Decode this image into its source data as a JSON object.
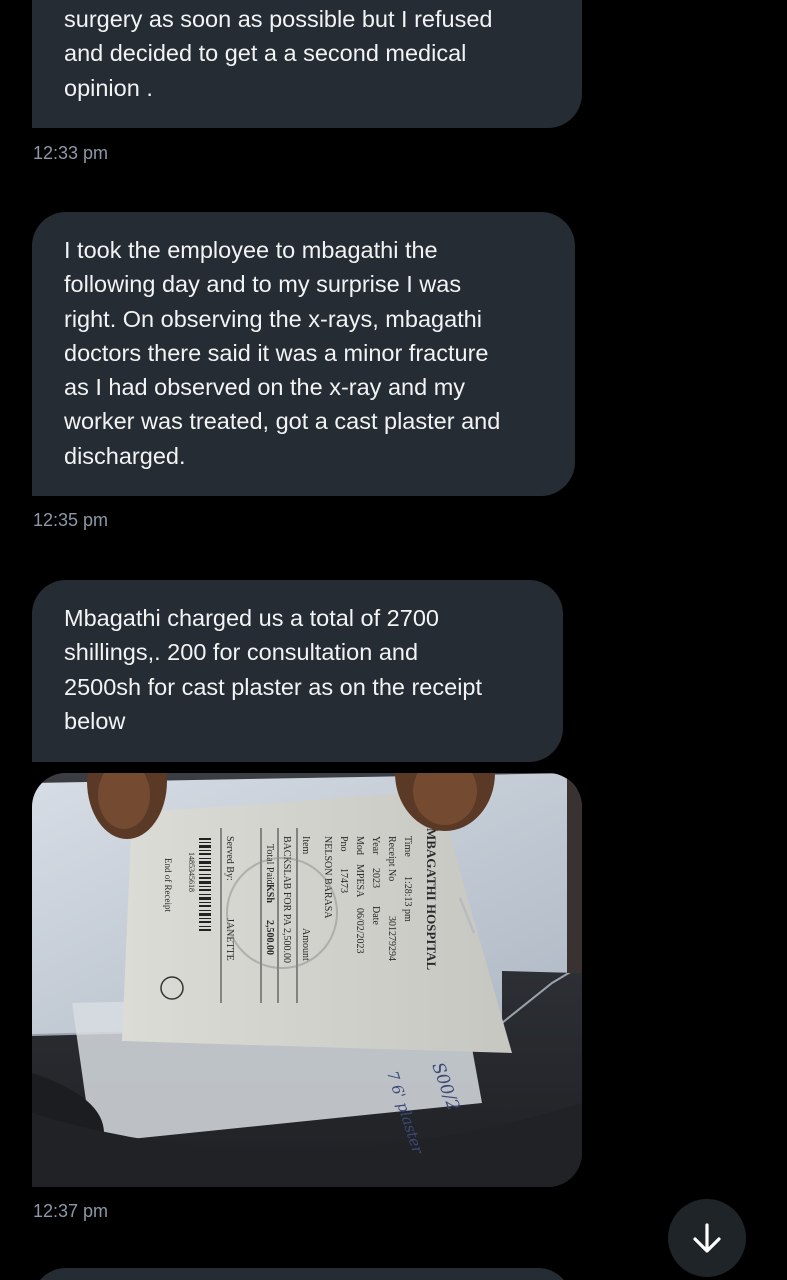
{
  "messages": [
    {
      "text": "surgery as soon as possible but I refused and decided to get a a second medical opinion .",
      "lines": [
        "surgery as soon as possible but I refused",
        "and decided to get a a second medical",
        "opinion ."
      ],
      "time": "12:33 pm"
    },
    {
      "text": "I took the employee to mbagathi the following day and to my surprise I was right. On observing the x-rays, mbagathi doctors there  said it was a minor fracture as I had observed on the x-ray and my worker was treated, got a cast plaster and discharged.",
      "lines": [
        "I took the employee to mbagathi the",
        "following day and to my surprise I was",
        "right. On observing the x-rays, mbagathi",
        "doctors there  said it was a minor fracture",
        "as I had observed on the x-ray and my",
        "worker was treated, got a cast plaster and",
        "discharged."
      ],
      "time": "12:35 pm"
    },
    {
      "text": "Mbagathi charged us a total of 2700 shillings,. 200 for consultation and 2500sh for cast plaster as on the receipt below",
      "lines": [
        "Mbagathi charged us a total of 2700",
        "shillings,. 200 for consultation and",
        "2500sh for cast plaster as on the receipt",
        "below"
      ]
    }
  ],
  "photo_message": {
    "time": "12:37 pm",
    "receipt": {
      "hospital": "MBAGATHI HOSPITAL",
      "time_label": "Time",
      "time_value": "1:28:13 pm",
      "receipt_no_label": "Receipt No",
      "receipt_no_value": "301279294",
      "year_label": "Year",
      "year_value": "2023",
      "date_label": "Date",
      "mode_label": "Mod",
      "mode_value": "MPESA",
      "date_value": "06/02/2023",
      "pno_label": "Pno",
      "pno_value": "17473",
      "patient_name": "NELSON BARASA",
      "item_label": "Item",
      "amount_label": "Amount",
      "item_value": "BACKSLAB FOR PA",
      "item_amount": "2,500.00",
      "total_label": "Total Paid",
      "currency": "KSh",
      "total_value": "2,500.00",
      "served_by_label": "Served By:",
      "served_by_value": "JANETTE",
      "barcode_number": "1485345618",
      "footer": "End of Receipt",
      "handwriting_1": "S00/2",
      "handwriting_2": "7 6' plaster"
    }
  },
  "scroll_button": {
    "icon": "arrow-down-icon",
    "color": "#ffffff",
    "background": "#1f2428"
  },
  "colors": {
    "background": "#000000",
    "bubble": "#262c33",
    "text": "#f1f3f4",
    "timestamp": "#8b98a5"
  }
}
